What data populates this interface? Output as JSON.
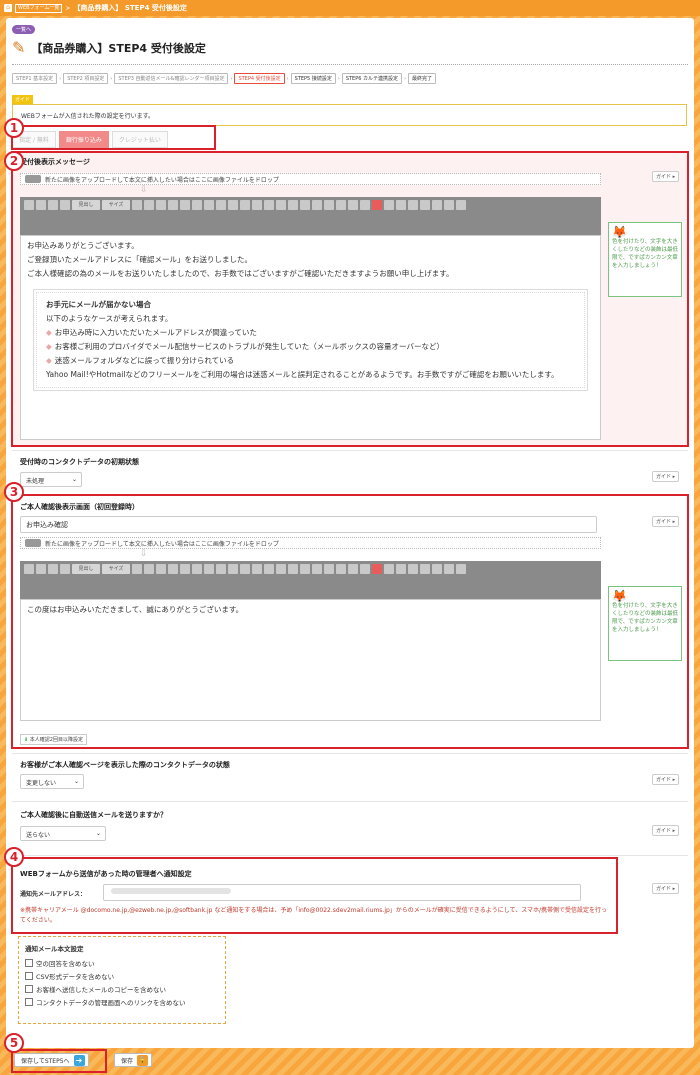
{
  "topbar": {
    "crumbs": [
      "WEBフォーム一覧"
    ],
    "current": "【商品券購入】 STEP4 受付後設定"
  },
  "back_label": "一覧へ",
  "page_title": "【商品券購入】STEP4 受付後設定",
  "steps": [
    "STEP1 基本設定",
    "STEP2 項目設定",
    "STEP3 自動返信メール&確認レンダー項目設定",
    "STEP4 受付後設定",
    "STEP5 接続設定",
    "STEP6 カルテ連携設定",
    "最終完了"
  ],
  "guide_tag": "ガイド",
  "info_text": "WEBフォームが入信された際の設定を行います。",
  "tabs": [
    "指定 / 無料",
    "銀行振り込み",
    "クレジット払い"
  ],
  "guide_btn": "ガイド",
  "dropzone_text": "新たに画像をアップロードして本文に挿入したい場合はここに画像ファイルをドロップ",
  "toolbar": {
    "heading": "見出し",
    "size": "サイズ"
  },
  "mascot_text": "色を付けたり、文字を大きくしたりなどの装飾は最低限で、ですぱカンカン文章を入力しましょう！",
  "section1": {
    "label": "受付後表示メッセージ",
    "body": [
      "お申込みありがとうございます。",
      "ご登録頂いたメールアドレスに「確認メール」をお送りしました。",
      "ご本人様確認の為のメールをお送りいたしましたので、お手数ではございますがご確認いただきますようお願い申し上げます。"
    ],
    "box_title": "お手元にメールが届かない場合",
    "box_intro": "以下のようなケースが考えられます。",
    "box_items": [
      "お申込み時に入力いただいたメールアドレスが間違っていた",
      "お客様ご利用のプロバイダでメール配信サービスのトラブルが発生していた（メールボックスの容量オーバーなど）",
      "迷惑メールフォルダなどに誤って振り分けられている"
    ],
    "box_note": "Yahoo Mail!やHotmailなどのフリーメールをご利用の場合は迷惑メールと誤判定されることがあるようです。お手数ですがご確認をお願いいたします。"
  },
  "section_status": {
    "label": "受付時のコンタクトデータの初期状態",
    "value": "未処理"
  },
  "section3": {
    "label": "ご本人確認後表示画面（初回登録時）",
    "title_value": "お申込み確認",
    "body": "この度はお申込みいただきまして、誠にありがとうございます。",
    "small_btn": "本人確認2回目以降設定"
  },
  "section_confirm_status": {
    "label": "お客様がご本人確認ページを表示した際のコンタクトデータの状態",
    "value": "変更しない"
  },
  "section_autosend": {
    "label": "ご本人確認後に自動送信メールを送りますか？",
    "value": "送らない"
  },
  "section4": {
    "label": "WEBフォームから送信があった時の管理者へ通知設定",
    "email_label": "通知先メールアドレス：",
    "email_value": "",
    "notice": "※携帯キャリアメール @docomo.ne.jp,@ezweb.ne.jp,@softbank.jp など通知をする場合は、予め「info@0022.sdev2mail.riums.jp」からのメールが確実に受信できるようにして、スマホ/携帯側で受信設定を行ってください。"
  },
  "mail_settings": {
    "title": "通知メール本文設定",
    "options": [
      "空の回答を含めない",
      "CSV形式データを含めない",
      "お客様へ送信したメールのコピーを含めない",
      "コンタクトデータの管理画面へのリンクを含めない"
    ]
  },
  "footer": {
    "next_label": "保存してSTEP5へ",
    "save_label": "保存"
  },
  "badges": [
    "1",
    "2",
    "3",
    "4",
    "5"
  ]
}
